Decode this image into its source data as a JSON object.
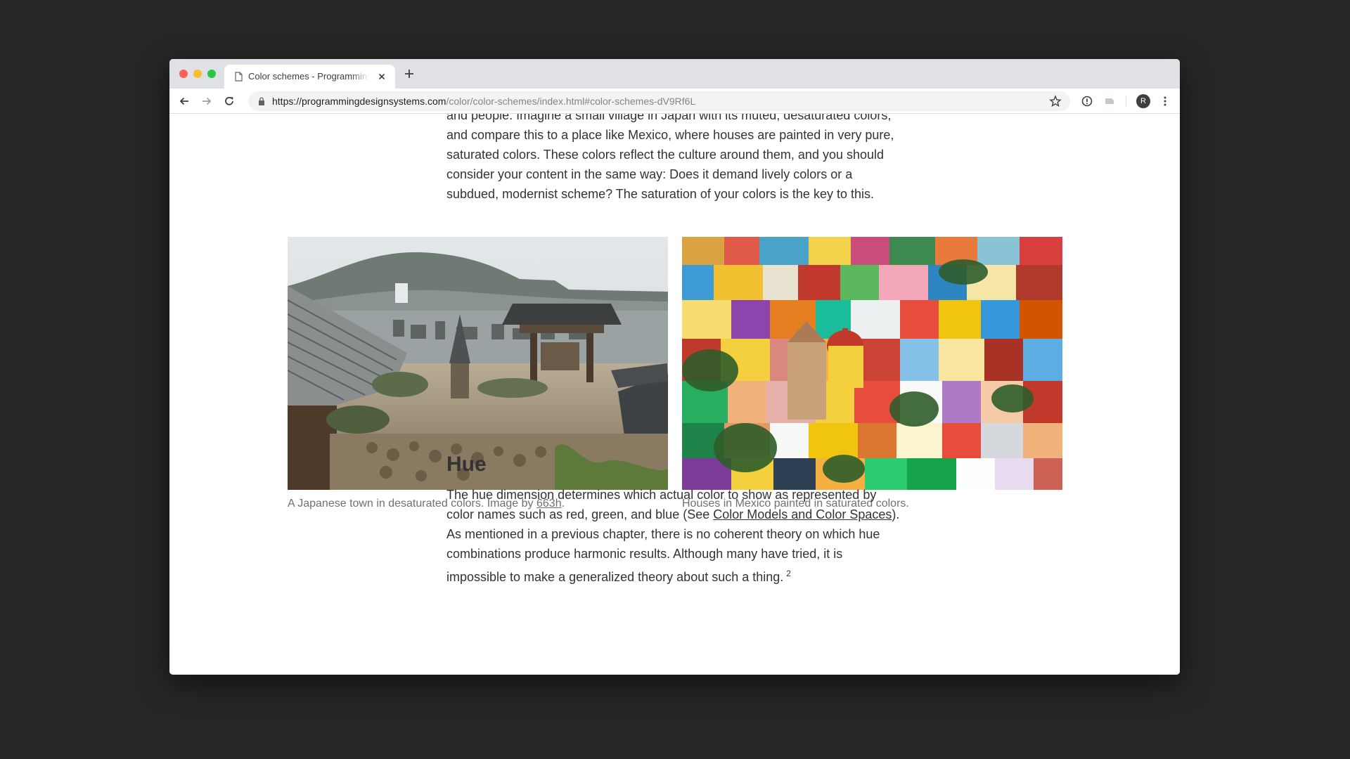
{
  "browser": {
    "tab_title": "Color schemes - Programming Design Systems",
    "url_host": "https://programmingdesignsystems.com",
    "url_path": "/color/color-schemes/index.html#color-schemes-dV9Rf6L",
    "avatar_letter": "R"
  },
  "article": {
    "para1": "and people. Imagine a small village in Japan with its muted, desaturated colors, and compare this to a place like Mexico, where houses are painted in very pure, saturated colors. These colors reflect the culture around them, and you should consider your content in the same way: Does it demand lively colors or a subdued, modernist scheme? The saturation of your colors is the key to this.",
    "caption_left_text": "A Japanese town in desaturated colors. Image by ",
    "caption_left_link": "663h",
    "caption_left_end": ".",
    "caption_right": "Houses in Mexico painted in saturated colors.",
    "heading": "Hue",
    "para2_before": "The hue dimension determines which actual color to show as represented by color names such as red, green, and blue (See ",
    "para2_link": "Color Models and Color Spaces",
    "para2_after": "). As mentioned in a previous chapter, there is no coherent theory on which hue combinations produce harmonic results. Although many have tried, it is impossible to make a generalized theory about such a thing.",
    "footnote": "2"
  },
  "colors": {
    "window_bg": "#262626",
    "tabstrip": "#dfe1e5",
    "text": "#333333",
    "caption": "#707070"
  }
}
